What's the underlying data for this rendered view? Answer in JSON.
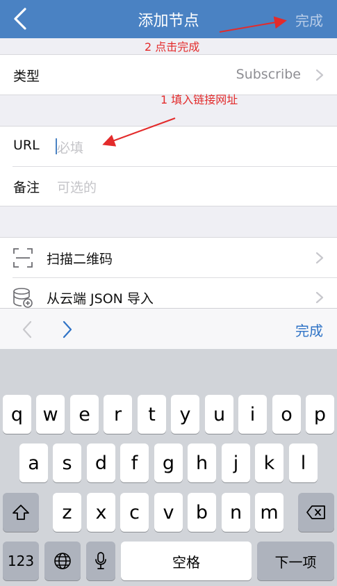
{
  "nav": {
    "title": "添加节点",
    "done": "完成"
  },
  "annotations": {
    "step2": "2 点击完成",
    "step1": "1 填入链接网址"
  },
  "type_row": {
    "label": "类型",
    "value": "Subscribe"
  },
  "url_row": {
    "label": "URL",
    "placeholder": "必填"
  },
  "note_row": {
    "label": "备注",
    "placeholder": "可选的"
  },
  "actions": {
    "scan": "扫描二维码",
    "import_json": "从云端 JSON 导入"
  },
  "accessory": {
    "done": "完成"
  },
  "keyboard": {
    "row1": [
      "q",
      "w",
      "e",
      "r",
      "t",
      "y",
      "u",
      "i",
      "o",
      "p"
    ],
    "row2": [
      "a",
      "s",
      "d",
      "f",
      "g",
      "h",
      "j",
      "k",
      "l"
    ],
    "row3": [
      "z",
      "x",
      "c",
      "v",
      "b",
      "n",
      "m"
    ],
    "numbers": "123",
    "space": "空格",
    "next": "下一项"
  },
  "colors": {
    "nav": "#4a82c3",
    "accent": "#2f73c6",
    "annotation": "#e32b2b"
  }
}
